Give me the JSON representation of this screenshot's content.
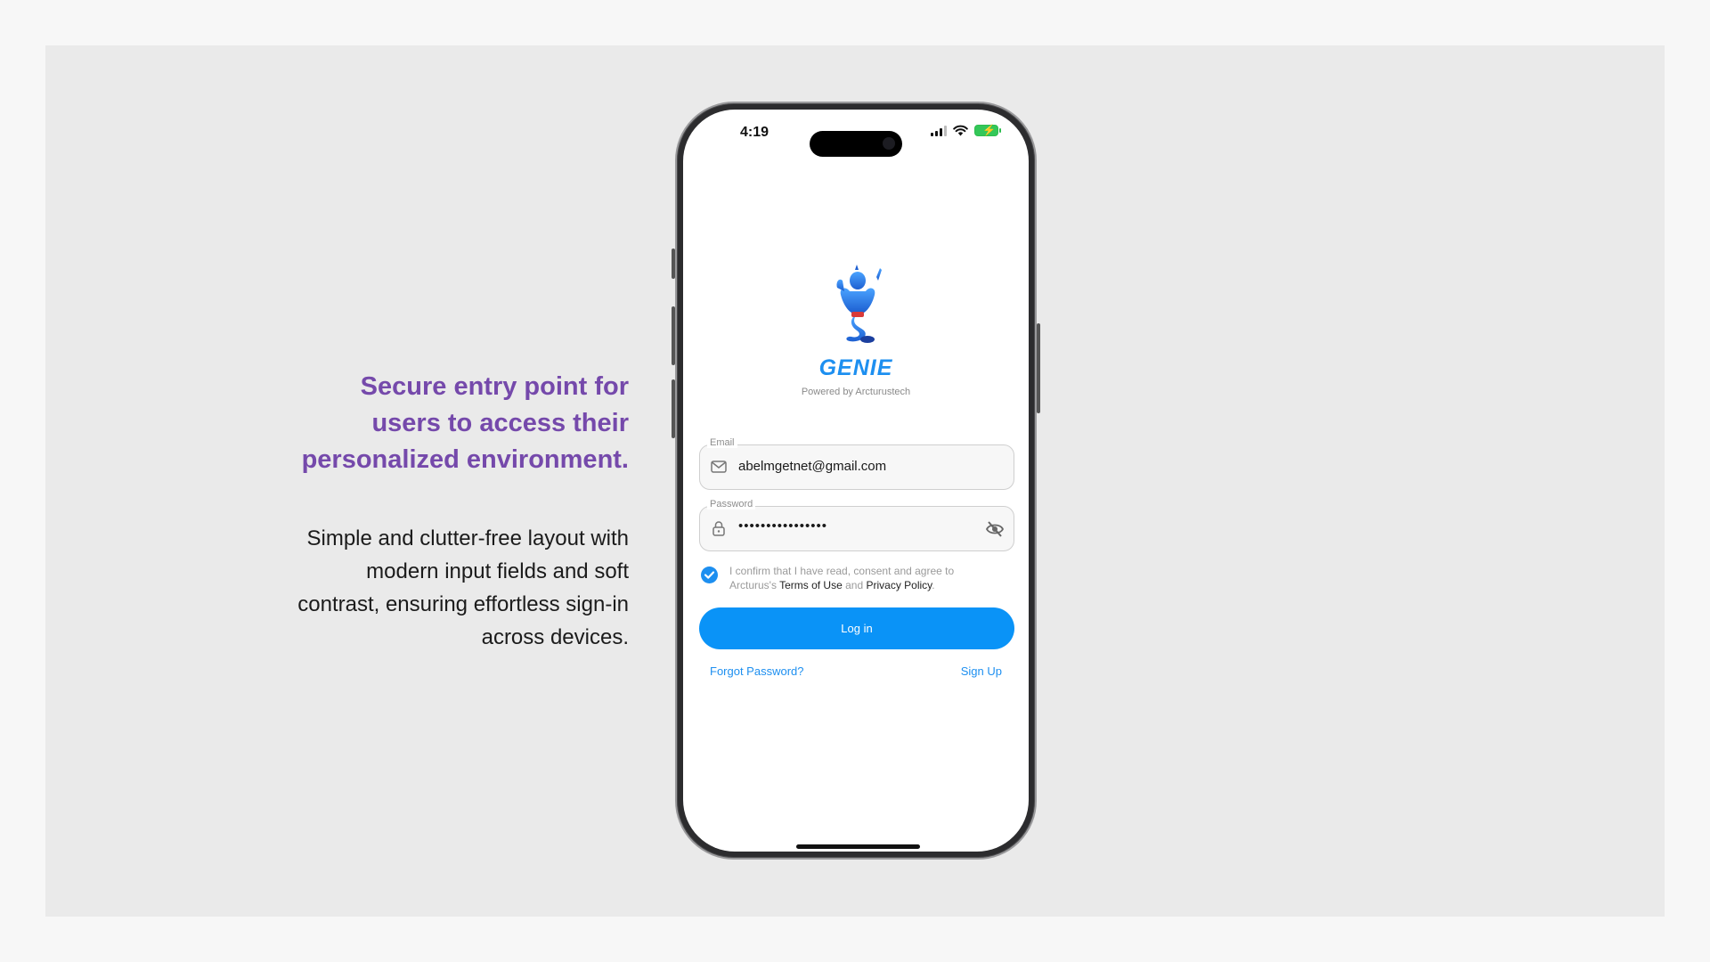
{
  "caption": {
    "headline_lines": [
      "Secure entry point for",
      "users to access their",
      "personalized environment."
    ],
    "description_lines": [
      "Simple and clutter-free layout with",
      "modern input fields and soft",
      "contrast, ensuring effortless sign-in",
      "across devices."
    ]
  },
  "status_bar": {
    "time": "4:19"
  },
  "brand": {
    "name": "GENIE",
    "powered_by": "Powered by Arcturustech"
  },
  "email_field": {
    "label": "Email",
    "value": "abelmgetnet@gmail.com",
    "icon": "mail-icon"
  },
  "password_field": {
    "label": "Password",
    "value": "••••••••••••••••",
    "icon": "lock-icon",
    "toggle_icon": "eye-off-icon"
  },
  "consent": {
    "checked": true,
    "text_before": "I confirm that I have read, consent and agree to Arcturus's ",
    "terms": "Terms of Use",
    "and": " and ",
    "privacy": "Privacy Policy",
    "period": "."
  },
  "actions": {
    "login_label": "Log in",
    "forgot_label": "Forgot Password?",
    "signup_label": "Sign Up"
  },
  "colors": {
    "accent": "#0a93f7",
    "headline": "#7549ab"
  }
}
